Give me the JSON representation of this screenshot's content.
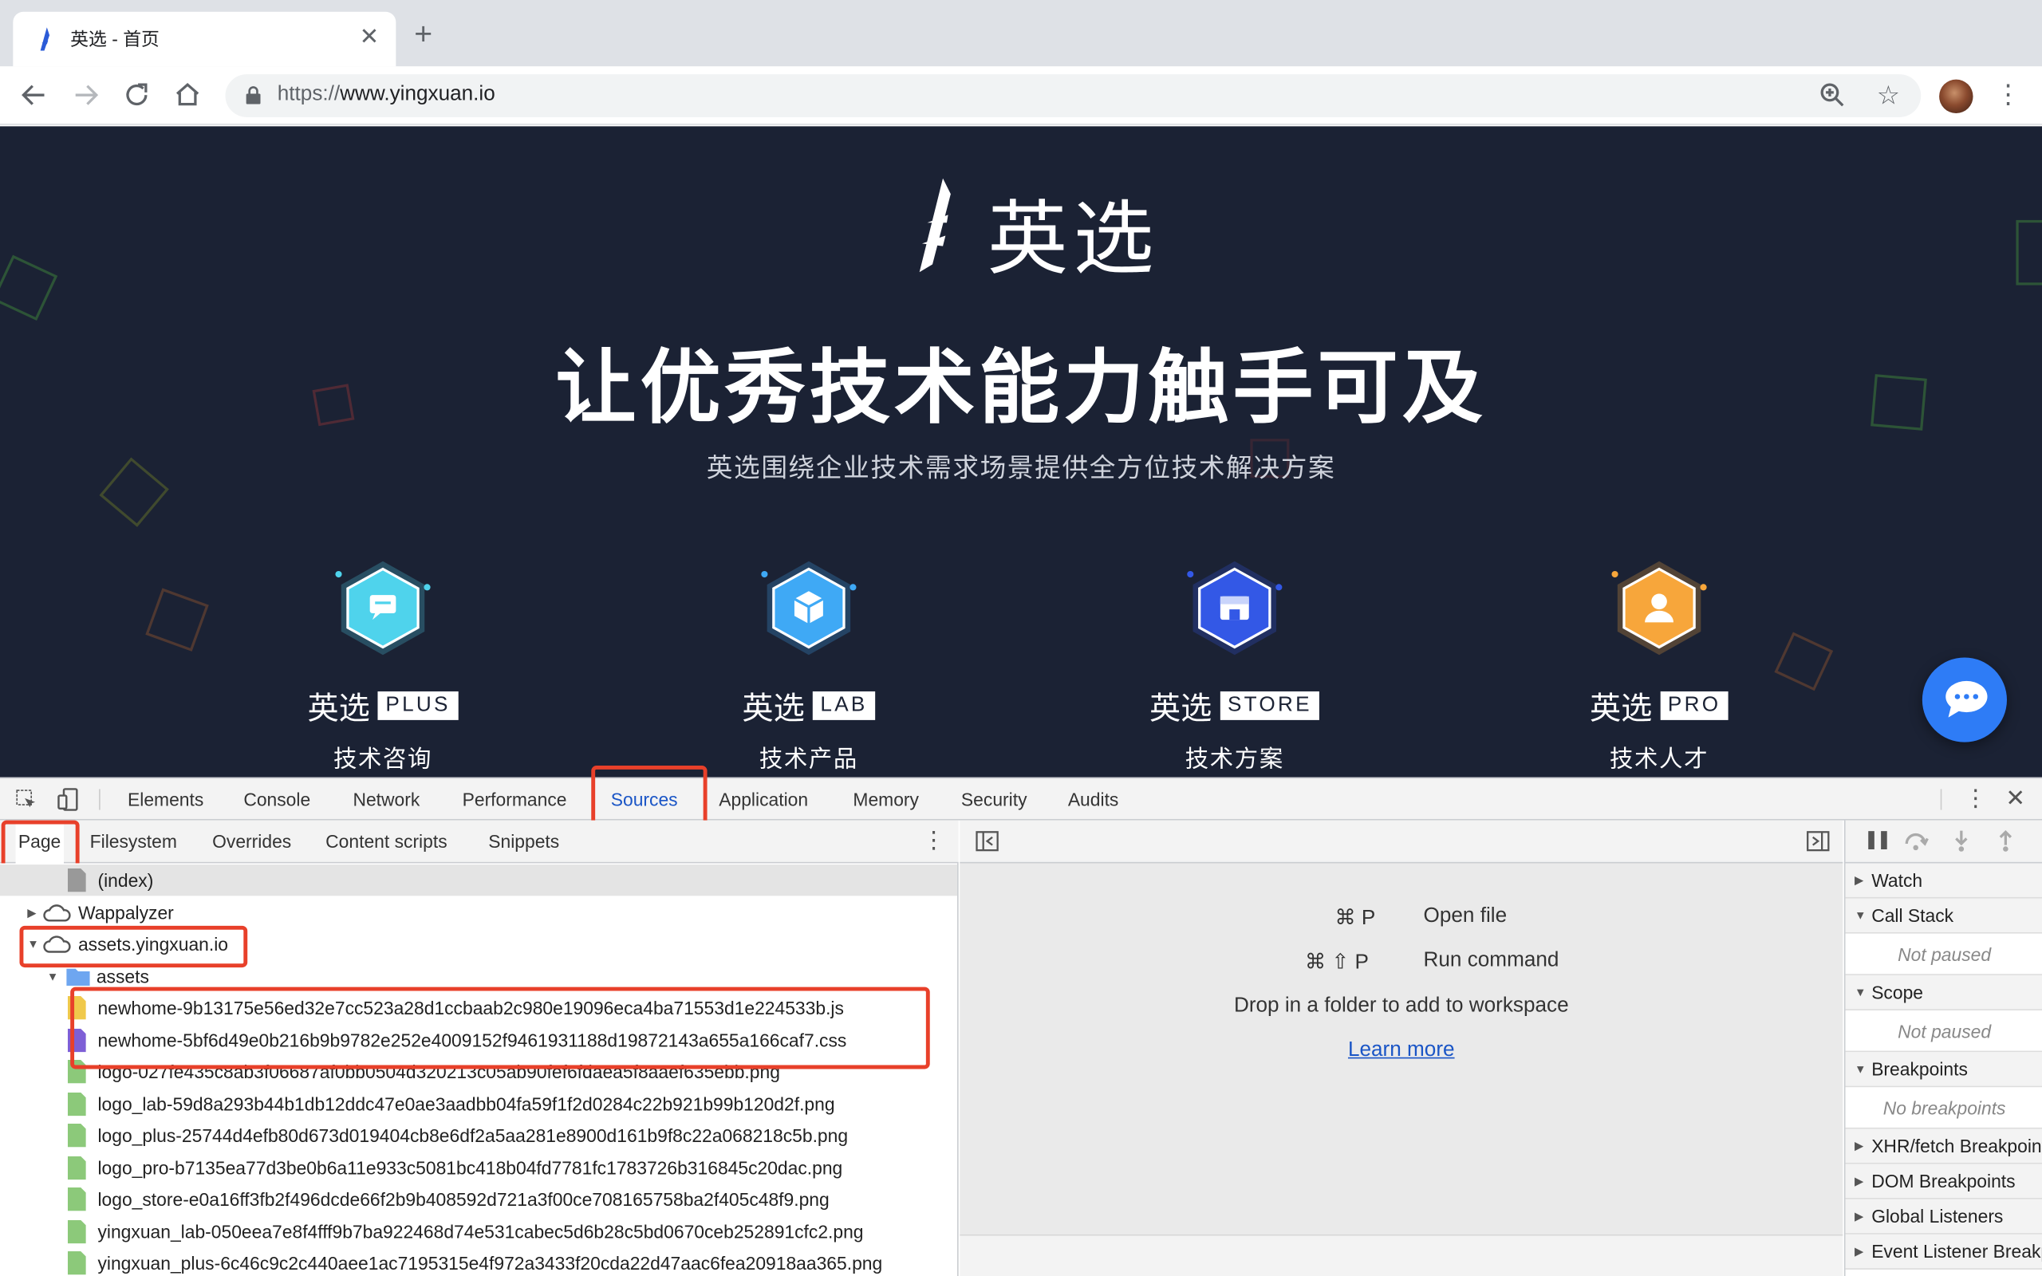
{
  "browser": {
    "tab_title": "英选 - 首页",
    "tab_close": "✕",
    "new_tab": "+",
    "url_scheme": "https://",
    "url_host": "www.yingxuan.io"
  },
  "hero": {
    "logo_text": "英选",
    "headline": "让优秀技术能力触手可及",
    "subline": "英选围绕企业技术需求场景提供全方位技术解决方案",
    "products": [
      {
        "brand": "英选",
        "badge": "PLUS",
        "subtitle": "技术咨询",
        "color": "#4fd3ec",
        "icon": "chat-icon"
      },
      {
        "brand": "英选",
        "badge": "LAB",
        "subtitle": "技术产品",
        "color": "#3fa9f5",
        "icon": "cube-icon"
      },
      {
        "brand": "英选",
        "badge": "STORE",
        "subtitle": "技术方案",
        "color": "#3358e6",
        "icon": "store-icon"
      },
      {
        "brand": "英选",
        "badge": "PRO",
        "subtitle": "技术人才",
        "color": "#f7a63b",
        "icon": "person-icon"
      }
    ]
  },
  "devtools": {
    "main_tabs": [
      "Elements",
      "Console",
      "Network",
      "Performance",
      "Sources",
      "Application",
      "Memory",
      "Security",
      "Audits"
    ],
    "active_main_tab": "Sources",
    "navigator_tabs": [
      "Page",
      "Filesystem",
      "Overrides",
      "Content scripts",
      "Snippets"
    ],
    "active_navigator_tab": "Page",
    "tree": [
      {
        "label": "(index)",
        "type": "file-gray",
        "indent": 2
      },
      {
        "label": "Wappalyzer",
        "type": "cloud",
        "indent": 0,
        "arrow": "right"
      },
      {
        "label": "assets.yingxuan.io",
        "type": "cloud",
        "indent": 0,
        "arrow": "down"
      },
      {
        "label": "assets",
        "type": "folder",
        "indent": 1,
        "arrow": "down"
      },
      {
        "label": "newhome-9b13175e56ed32e7cc523a28d1ccbaab2c980e19096eca4ba71553d1e224533b.js",
        "type": "file-js",
        "indent": 2
      },
      {
        "label": "newhome-5bf6d49e0b216b9b9782e252e4009152f9461931188d19872143a655a166caf7.css",
        "type": "file-css",
        "indent": 2
      },
      {
        "label": "logo-027fe435c8ab3f06687af0bb0504d320213c05ab90fef6fdaea5f8aaef635ebb.png",
        "type": "file-img",
        "indent": 2
      },
      {
        "label": "logo_lab-59d8a293b44b1db12ddc47e0ae3aadbb04fa59f1f2d0284c22b921b99b120d2f.png",
        "type": "file-img",
        "indent": 2
      },
      {
        "label": "logo_plus-25744d4efb80d673d019404cb8e6df2a5aa281e8900d161b9f8c22a068218c5b.png",
        "type": "file-img",
        "indent": 2
      },
      {
        "label": "logo_pro-b7135ea77d3be0b6a11e933c5081bc418b04fd7781fc1783726b316845c20dac.png",
        "type": "file-img",
        "indent": 2
      },
      {
        "label": "logo_store-e0a16ff3fb2f496dcde66f2b9b408592d721a3f00ce708165758ba2f405c48f9.png",
        "type": "file-img",
        "indent": 2
      },
      {
        "label": "yingxuan_lab-050eea7e8f4fff9b7ba922468d74e531cabec5d6b28c5bd0670ceb252891cfc2.png",
        "type": "file-img",
        "indent": 2
      },
      {
        "label": "yingxuan_plus-6c46c9c2c440aee1ac7195315e4f972a3433f20cda22d47aac6fea20918aa365.png",
        "type": "file-img",
        "indent": 2
      }
    ],
    "editor_hints": {
      "open_file_keys": "⌘ P",
      "open_file_label": "Open file",
      "run_command_keys": "⌘ ⇧ P",
      "run_command_label": "Run command",
      "drop_text": "Drop in a folder to add to workspace",
      "learn_more": "Learn more"
    },
    "sidebar": {
      "watch": "Watch",
      "call_stack": "Call Stack",
      "call_stack_status": "Not paused",
      "scope": "Scope",
      "scope_status": "Not paused",
      "breakpoints": "Breakpoints",
      "breakpoints_status": "No breakpoints",
      "xhr": "XHR/fetch Breakpoints",
      "dom": "DOM Breakpoints",
      "global": "Global Listeners",
      "event": "Event Listener Breakpoints"
    },
    "highlight_color": "#e8402a"
  }
}
